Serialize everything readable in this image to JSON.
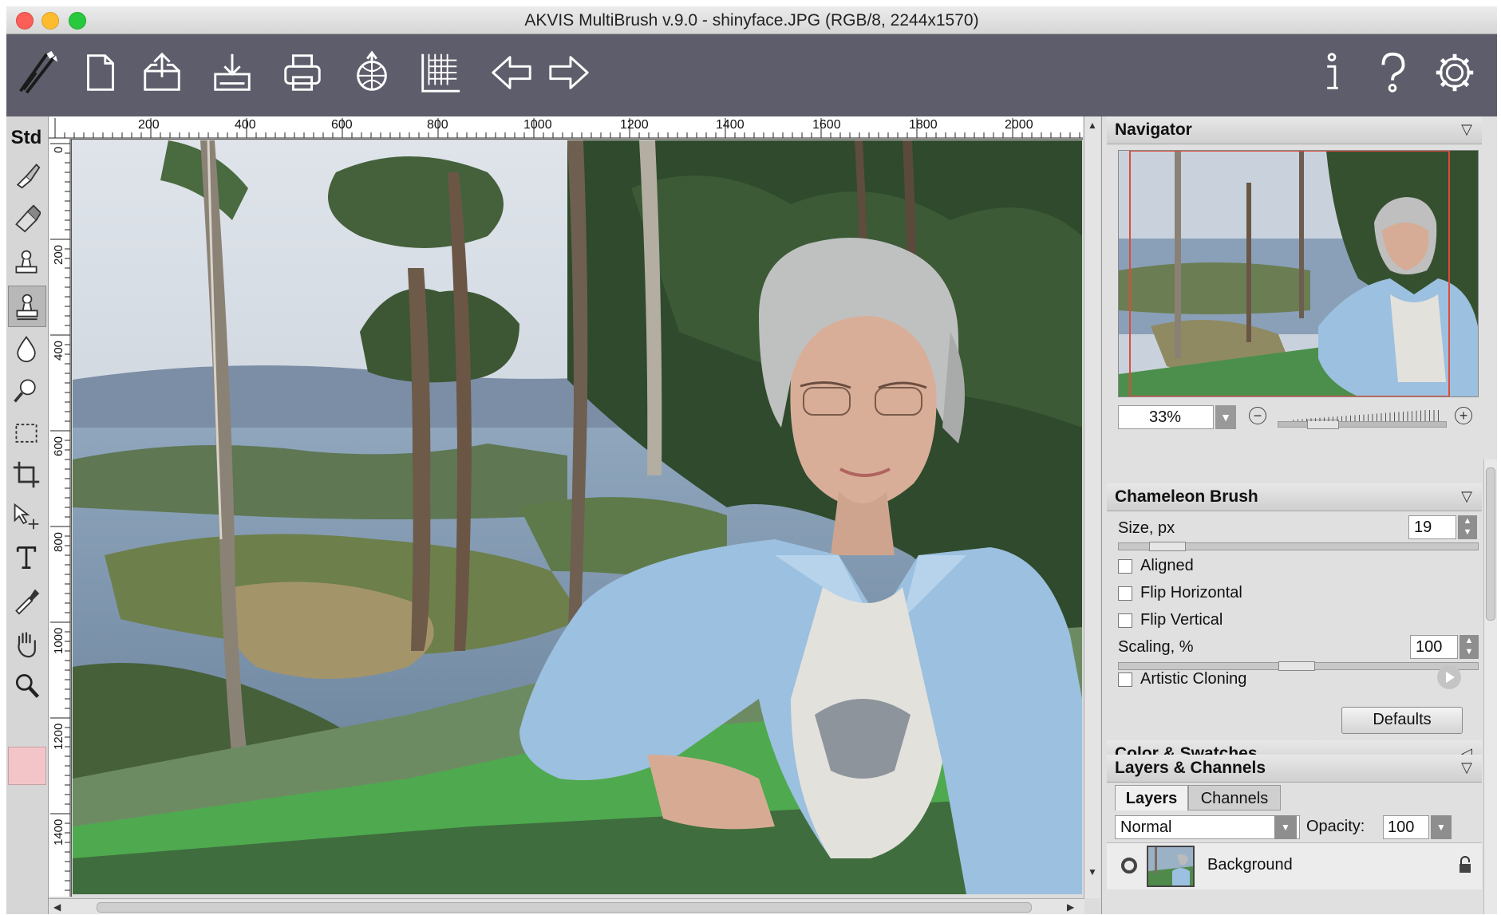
{
  "window": {
    "title": "AKVIS MultiBrush v.9.0 - shinyface.JPG (RGB/8, 2244x1570)"
  },
  "toolbar": {
    "items": [
      {
        "icon": "brush-logo-icon"
      },
      {
        "icon": "new-document-icon"
      },
      {
        "icon": "open-icon"
      },
      {
        "icon": "save-icon"
      },
      {
        "icon": "print-icon"
      },
      {
        "icon": "share-icon"
      },
      {
        "icon": "ruler-icon"
      },
      {
        "icon": "undo-arrow-icon"
      },
      {
        "icon": "redo-arrow-icon"
      },
      {
        "icon": "info-icon"
      },
      {
        "icon": "help-icon"
      },
      {
        "icon": "settings-icon"
      }
    ]
  },
  "tools": {
    "mode_label": "Std",
    "items": [
      {
        "icon": "paint-brush-icon"
      },
      {
        "icon": "eraser-icon"
      },
      {
        "icon": "clone-stamp-icon"
      },
      {
        "icon": "chameleon-brush-icon",
        "active": true
      },
      {
        "icon": "blur-drop-icon"
      },
      {
        "icon": "smudge-icon"
      },
      {
        "icon": "rectangle-select-icon"
      },
      {
        "icon": "crop-icon"
      },
      {
        "icon": "move-icon"
      },
      {
        "icon": "text-icon"
      },
      {
        "icon": "eyedropper-icon"
      },
      {
        "icon": "hand-icon"
      },
      {
        "icon": "zoom-icon"
      }
    ],
    "swatch_color": "#f3c5c9"
  },
  "rulers": {
    "horizontal": [
      "200",
      "400",
      "600",
      "800",
      "1000",
      "1200",
      "1400",
      "1600",
      "1800",
      "2000"
    ],
    "vertical": [
      "0",
      "200",
      "400",
      "600",
      "800",
      "1000",
      "1200",
      "1400"
    ]
  },
  "navigator": {
    "title": "Navigator",
    "zoom": "33%"
  },
  "chameleon_brush": {
    "title": "Chameleon Brush",
    "size_label": "Size, px",
    "size_value": "19",
    "aligned_label": "Aligned",
    "flip_h_label": "Flip Horizontal",
    "flip_v_label": "Flip Vertical",
    "scaling_label": "Scaling, %",
    "scaling_value": "100",
    "artistic_label": "Artistic Cloning",
    "defaults_label": "Defaults"
  },
  "color_swatches": {
    "title": "Color & Swatches"
  },
  "layers": {
    "title": "Layers & Channels",
    "tab_layers": "Layers",
    "tab_channels": "Channels",
    "blend_mode": "Normal",
    "opacity_label": "Opacity:",
    "opacity_value": "100",
    "layer_name": "Background"
  }
}
